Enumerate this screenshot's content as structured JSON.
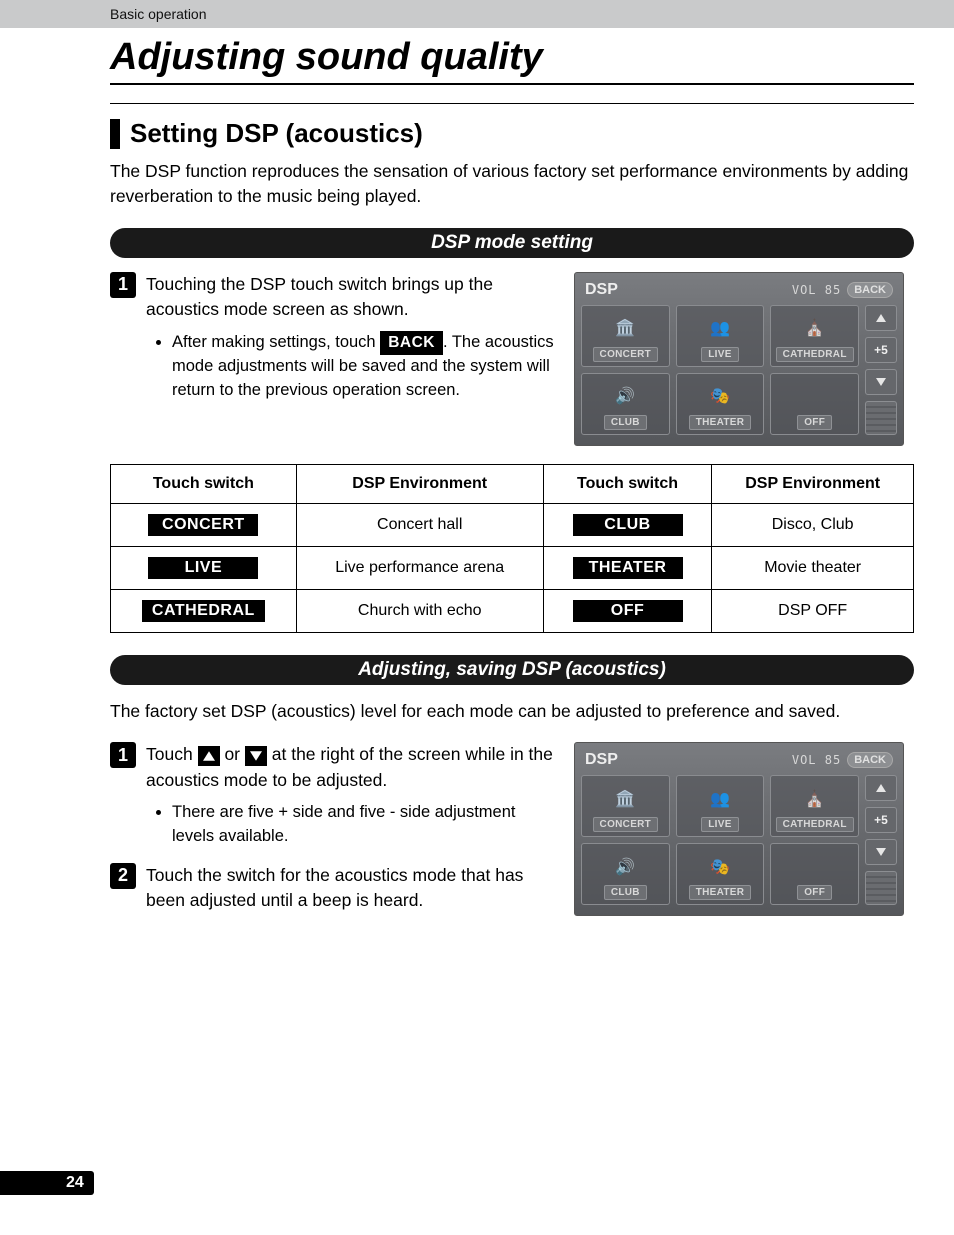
{
  "header": {
    "breadcrumb": "Basic operation"
  },
  "title": "Adjusting sound quality",
  "setting": {
    "heading": "Setting DSP (acoustics)",
    "intro": "The DSP function reproduces the sensation of various factory set performance environments by adding reverberation to the music being played."
  },
  "pill1": "DSP mode setting",
  "step1": {
    "num": "1",
    "text": "Touching the DSP touch switch brings up the acoustics mode screen as shown.",
    "bullet_pre": "After making settings, touch ",
    "bullet_key": "BACK",
    "bullet_post": ". The acoustics mode adjustments will be saved and the system will return to the previous operation screen."
  },
  "device": {
    "title": "DSP",
    "vol_label": "VOL",
    "vol_value": "85",
    "back": "BACK",
    "side_value": "+5",
    "cells": [
      "CONCERT",
      "LIVE",
      "CATHEDRAL",
      "CLUB",
      "THEATER",
      "OFF"
    ]
  },
  "table": {
    "head": [
      "Touch switch",
      "DSP Environment",
      "Touch switch",
      "DSP Environment"
    ],
    "rows": [
      {
        "k1": "CONCERT",
        "e1": "Concert hall",
        "k2": "CLUB",
        "e2": "Disco, Club"
      },
      {
        "k1": "LIVE",
        "e1": "Live performance arena",
        "k2": "THEATER",
        "e2": "Movie theater"
      },
      {
        "k1": "CATHEDRAL",
        "e1": "Church with echo",
        "k2": "OFF",
        "e2": "DSP OFF"
      }
    ]
  },
  "pill2": "Adjusting, saving DSP (acoustics)",
  "adjust_intro": "The factory set DSP (acoustics) level for each mode can be adjusted to preference and saved.",
  "adj_step1": {
    "num": "1",
    "pre": "Touch ",
    "mid": " or ",
    "post": " at the right of the screen while in the acoustics mode to be adjusted.",
    "bullet": "There are five + side and five - side adjustment levels available."
  },
  "adj_step2": {
    "num": "2",
    "text": "Touch the switch for the acoustics mode that has been adjusted until a beep is heard."
  },
  "page_number": "24"
}
